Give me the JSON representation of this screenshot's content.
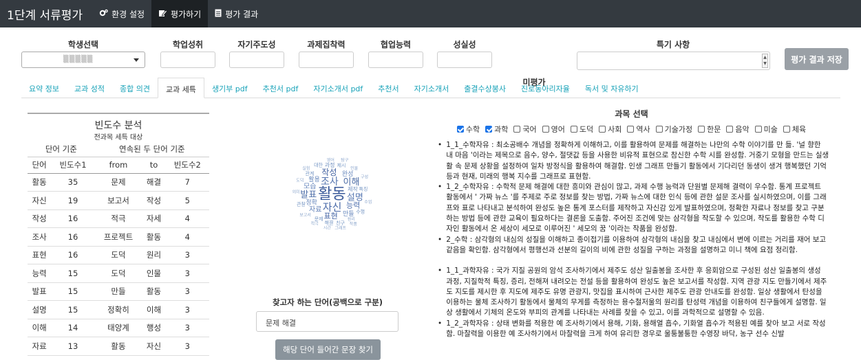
{
  "app": {
    "title": "1단계 서류평가"
  },
  "nav": [
    {
      "label": "환경 설정",
      "icon": "gears-icon"
    },
    {
      "label": "평가하기",
      "icon": "edit-icon"
    },
    {
      "label": "평가 결과",
      "icon": "file-icon"
    }
  ],
  "criteria": {
    "student": "학생선택",
    "grade": "학업성취",
    "self": "자기주도성",
    "focus": "과제집착력",
    "collab": "협업능력",
    "sincerity": "성실성",
    "unrated": "미평가",
    "special": "특기 사항",
    "student_value": "▒▒▒▒▒",
    "save": "평가 결과 저장"
  },
  "tabs": [
    "요약 정보",
    "교과 성적",
    "종합 의견",
    "교과 세특",
    "생기부 pdf",
    "추천서 pdf",
    "자기소개서 pdf",
    "추천서",
    "자기소개서",
    "출결수상봉사",
    "진로동아리자율",
    "독서 및 자유하기"
  ],
  "freq": {
    "title": "빈도수 분석",
    "subtitle": "전과목 세특 대상",
    "group1": "단어 기준",
    "group2": "연속된 두 단어 기준",
    "cols": [
      "단어",
      "빈도수1",
      "from",
      "to",
      "빈도수2"
    ],
    "rows": [
      [
        "활동",
        "35",
        "문제",
        "해결",
        "7"
      ],
      [
        "자신",
        "19",
        "보고서",
        "작성",
        "5"
      ],
      [
        "작성",
        "16",
        "적극",
        "자세",
        "4"
      ],
      [
        "조사",
        "16",
        "프로젝트",
        "활동",
        "4"
      ],
      [
        "표현",
        "16",
        "도덕",
        "원리",
        "3"
      ],
      [
        "능력",
        "15",
        "도덕",
        "인물",
        "3"
      ],
      [
        "발표",
        "15",
        "만들",
        "활동",
        "3"
      ],
      [
        "설명",
        "15",
        "정확히",
        "이해",
        "3"
      ],
      [
        "이해",
        "14",
        "태양계",
        "행성",
        "3"
      ],
      [
        "자료",
        "13",
        "활동",
        "자신",
        "3"
      ]
    ]
  },
  "cloud": {
    "words": [
      {
        "t": "활동",
        "s": 22,
        "c": "#3a5a9a"
      },
      {
        "t": "자신",
        "s": 15,
        "c": "#4a6aa8"
      },
      {
        "t": "조사",
        "s": 14,
        "c": "#5575b0"
      },
      {
        "t": "이해",
        "s": 13,
        "c": "#4b6ba5"
      },
      {
        "t": "설명",
        "s": 13,
        "c": "#5878b2"
      },
      {
        "t": "발표",
        "s": 13,
        "c": "#5070aa"
      },
      {
        "t": "작성",
        "s": 12,
        "c": "#4060a0"
      },
      {
        "t": "표현",
        "s": 11,
        "c": "#4565a5"
      },
      {
        "t": "능력",
        "s": 11,
        "c": "#5575b0"
      },
      {
        "t": "자료",
        "s": 10,
        "c": "#6080b8"
      },
      {
        "t": "모습",
        "s": 10,
        "c": "#6585bb"
      },
      {
        "t": "정확",
        "s": 9,
        "c": "#6a8abe"
      },
      {
        "t": "활용",
        "s": 9,
        "c": "#6a8abe"
      },
      {
        "t": "완성",
        "s": 9,
        "c": "#6a8abe"
      },
      {
        "t": "만들",
        "s": 9,
        "c": "#6a8abe"
      },
      {
        "t": "제작",
        "s": 8,
        "c": "#7090c0"
      },
      {
        "t": "과정",
        "s": 8,
        "c": "#7090c0"
      },
      {
        "t": "문제",
        "s": 7,
        "c": "#7898c5"
      },
      {
        "t": "해결",
        "s": 7,
        "c": "#7898c5"
      },
      {
        "t": "관계",
        "s": 7,
        "c": "#7898c5"
      },
      {
        "t": "제시",
        "s": 7,
        "c": "#7898c5"
      },
      {
        "t": "특징",
        "s": 7,
        "c": "#7898c5"
      },
      {
        "t": "친구",
        "s": 7,
        "c": "#7898c5"
      },
      {
        "t": "관찰",
        "s": 7,
        "c": "#7898c5"
      },
      {
        "t": "대한",
        "s": 7,
        "c": "#7898c5"
      },
      {
        "t": "수행",
        "s": 7,
        "c": "#7898c5"
      },
      {
        "t": "원리",
        "s": 6,
        "c": "#8aa5cc"
      },
      {
        "t": "인물",
        "s": 6,
        "c": "#8aa5cc"
      },
      {
        "t": "보고서",
        "s": 6,
        "c": "#8aa5cc"
      },
      {
        "t": "도덕",
        "s": 6,
        "c": "#8aa5cc"
      },
      {
        "t": "영어",
        "s": 6,
        "c": "#8aa5cc"
      },
      {
        "t": "시간",
        "s": 6,
        "c": "#8aa5cc"
      },
      {
        "t": "적극",
        "s": 6,
        "c": "#8aa5cc"
      },
      {
        "t": "의미",
        "s": 6,
        "c": "#8aa5cc"
      },
      {
        "t": "구성",
        "s": 6,
        "c": "#8aa5cc"
      },
      {
        "t": "수업",
        "s": 6,
        "c": "#8aa5cc"
      },
      {
        "t": "그래프",
        "s": 6,
        "c": "#8aa5cc"
      },
      {
        "t": "실험",
        "s": 6,
        "c": "#8aa5cc"
      },
      {
        "t": "탐구",
        "s": 6,
        "c": "#8aa5cc"
      },
      {
        "t": "작품",
        "s": 6,
        "c": "#8aa5cc"
      }
    ]
  },
  "finder": {
    "label": "찾고자 하는 단어(공백으로 구분)",
    "value": "문제 해결",
    "button": "해당 단어 들어간 문장 찾기"
  },
  "subjects": {
    "title": "과목 선택",
    "items": [
      {
        "label": "수학",
        "checked": true
      },
      {
        "label": "과학",
        "checked": true
      },
      {
        "label": "국어",
        "checked": false
      },
      {
        "label": "영어",
        "checked": false
      },
      {
        "label": "도덕",
        "checked": false
      },
      {
        "label": "사회",
        "checked": false
      },
      {
        "label": "역사",
        "checked": false
      },
      {
        "label": "기술가정",
        "checked": false
      },
      {
        "label": "한문",
        "checked": false
      },
      {
        "label": "음악",
        "checked": false
      },
      {
        "label": "미술",
        "checked": false
      },
      {
        "label": "체육",
        "checked": false
      }
    ]
  },
  "notes": [
    "1_1_수학자유 : 최소공배수 개념을 정확하게 이해하고, 이를 활용하여 문제를 해결하는 나만의 수학 이야기를 만 듦. '널 향한 내 마음 '이라는 제목으로 음수, 양수, 절댓값 등을 사용한 비유적 표현으로 참신한 수학 시를 완성함. 거중기 모형을 만드는 실생활 속 문제 상황을 설정하여 일차 방정식을 활용하여 해결함. 인생 그래프 만들기 활동에서 기다리던 동생이 생겨 행복했던 기억 등과 현재, 미래의 행복 지수를 그래프로 표현함.",
    "1_2_수학자유 : 수학적 문제 해결에 대한 흥미와 관심이 많고, 과제 수행 능력과 단원별 문제해 결력이 우수함. 통계 프로젝트 활동에서 ' 가짜 뉴스 '를 주제로 주로 정보를 찾는 방법, 가짜 뉴스에 대한 인식 등에 관한 설문 조사를 실시하였으며, 이를 그래프와 표로 나타내고 분석하여 완성도 높은 통계 포스터를 제작하고 자신감 있게 발표하였으며, 정확한 자료나 정보를 찾고 구분하는 방법 등에 관한 교육이 필요하다는 결론을 도출함. 주어진 조건에 맞는 삼각형을 작도할 수 있으며, 작도를 활용한 수학 디자인 활동에서 온 세상이 세모로 이루어진 ' 세모의 꿈 '이라는 작품을 완성함.",
    "2_수학 : 삼각형의 내심의 성질을 이해하고 종이접기를 이용하여 삼각형의 내심을 찾고 내심에서 변에 이르는 거리를 재어 보고 같음을 확인함. 삼각형에서 평행선과 선분의 길이의 비에 관한 성질을 구하는 과정을 설명하고 미니 책에 요점 정리함.",
    "",
    "1_1_과학자유 : 국가 지질 공원의 암석 조사하기에서 제주도 성산 일출봉을 조사한 후 응회암으로 구성된 성산 일출봉의 생성 과정, 지질학적 특징, 증리, 전해져 내려오는 전설 등을 활용하여 완성도 높은 보고서를 작성함. 지역 관광 지도 만들기에서 제주도 지도를 제시한 후 지도에 제주도 유명 관광지, 맛집을 표시하여 근사한 제주도 관광 안내도를 완성함. 일상 생활에서 탄성을 이용하는 물체 조사하기 활동에서 물체의 무게를 측정하는 용수철저울의 원리를 탄성력 개념을 이용하여 친구들에게 설명함. 일상 생활에서 기체의 온도와 부피의 관계를 나타내는 사례를 찾을 수 있고, 이를 과학적으로 설명할 수 있음.",
    "1_2_과학자유 : 상태 변화를 적용한 예 조사하기에서 용해, 기화, 용해열 흡수, 기화열 흡수가 적용된 예를 찾아 보고 서로 작성함. 마찰력을 이용한 예 조사하기에서 마찰력을 크게 하여 유리한 경우로 울퉁불퉁한 수영장 바닥, 농구 선수 신발"
  ]
}
